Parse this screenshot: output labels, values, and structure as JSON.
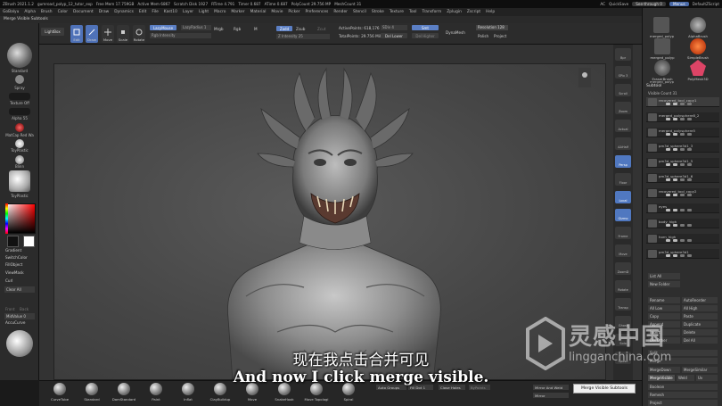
{
  "titlebar": {
    "app": "ZBrush 2021.1.2",
    "file": "gumroad_polyp_12_tutor_exp",
    "stats": [
      "Free Mem 17.759GB",
      "Active Mem 6867",
      "Scratch Disk 1927",
      "RTime 4.791",
      "Timer 0.687",
      "ATime 0.687",
      "PolyCount 29.756 MP",
      "MeshCount 31"
    ],
    "ac": "AC",
    "quicksave": "QuickSave",
    "see_through": "See-through 0",
    "menus_btn": "Menus",
    "script": "DefaultZScript"
  },
  "menubar": {
    "items": [
      "GoBalyu",
      "Alpha",
      "Brush",
      "Color",
      "Document",
      "Draw",
      "Dynamics",
      "Edit",
      "File",
      "Kast10",
      "Layer",
      "Light",
      "Macro",
      "Marker",
      "Material",
      "Movie",
      "Picker",
      "Preferences",
      "Render",
      "Stencil",
      "Stroke",
      "Texture",
      "Tool",
      "Transform",
      "Zplugin",
      "Zscript",
      "Help"
    ]
  },
  "subbar": {
    "label": "Merge Visible Subtools"
  },
  "toolbar": {
    "projection_master": "Projection Master",
    "lightbox": "LightBox",
    "edit": "Edit",
    "draw": "Draw",
    "move": "Move",
    "scale": "Scale",
    "rotate": "Rotate",
    "lazymouse": "LazyMouse",
    "lazyradius": "LazyRadius 1",
    "rgb_intensity": "Rgb Intensity",
    "mrgb": "Mrgb",
    "rgb": "Rgb",
    "m": "M",
    "zadd": "Zadd",
    "zsub": "Zsub",
    "zcut": "Zcut",
    "z_intensity": "Z Intensity 25",
    "focal_shift": "Focal Shift 0",
    "draw_size": "Draw Size 40",
    "active_points": "ActivePoints: 618,176",
    "total_points": "TotalPoints: 29.756 Mil",
    "sdiv": "SDiv 4",
    "del_lower": "Del Lower",
    "del_higher": "Del Higher",
    "dynamesh": "DynaMesh",
    "smt": "Smt",
    "resolution": "Resolution 128",
    "polish": "Polish",
    "project": "Project"
  },
  "left": {
    "standard": "Standard",
    "spray": "Spray",
    "texture_off": "Texture Off",
    "alpha": "Alpha 55",
    "matcap": "MatCap Red Wa",
    "toyplastic": "ToyPlastic",
    "blinn": "Blinn",
    "toyplastic2": "ToyPlastic",
    "gradient": "Gradient",
    "switchcolor": "SwitchColor",
    "fillobject": "FillObject",
    "viewmask": "ViewMask",
    "curl": "Curl",
    "clear_all": "Clear All",
    "front": "Front",
    "back": "Back",
    "midvalue": "MidValue 0",
    "accucurve": "AccuCurve"
  },
  "rightshelf": [
    "Bpr",
    "SPix 3",
    "Scroll",
    "Zoom",
    "Actual",
    "AAHalf",
    "Persp",
    "Floor",
    "Local",
    "Gizmo",
    "Frame",
    "Move",
    "ZoomD",
    "Rotate",
    "Transp",
    "Ghost",
    "Solo",
    "Xpose"
  ],
  "right": {
    "brushes": [
      "merged_polyp",
      "AlphaBrush",
      "merged_polyp",
      "SimpleBrush",
      "EraserBrush",
      "PolyMesh3D",
      "merged_polyp"
    ],
    "brush_count": "11",
    "subtool": "Subtool",
    "visible_count": "Visible Count 31",
    "rows": [
      "recovered_tool_copy1",
      "merged_polysphere8_2",
      "merged_polysphere5",
      "pm3d_sphere3d1_3",
      "pm3d_sphere3d1_5",
      "pm3d_sphere3d1_6",
      "recovered_tool_copy2",
      "eyes",
      "body_high",
      "horn_high",
      "pm3d_sphere3d1"
    ],
    "list_all": "List All",
    "new_folder": "New Folder",
    "rename": "Rename",
    "autoreorder": "AutoReorder",
    "all_low": "All Low",
    "all_high": "All High",
    "copy": "Copy",
    "paste": "Paste",
    "append": "Append",
    "duplicate": "Duplicate",
    "insert": "Insert",
    "delete": "Delete",
    "del_other": "Del Other",
    "del_all": "Del All",
    "split": "Split",
    "merge": "Merge",
    "mergedown": "MergeDown",
    "mergesimilar": "MergeSimilar",
    "mergevisible": "MergeVisible",
    "weld": "Weld",
    "uv": "Uv",
    "boolean": "Boolean",
    "remesh": "Remesh",
    "project": "Project"
  },
  "bottom": {
    "brushes": [
      "CurveTube",
      "Standard",
      "DamStandard",
      "Paint",
      "Inflat",
      "ClayBuildup",
      "Move",
      "SnakeHook",
      "Move Topologi",
      "Spiral"
    ],
    "auto_groups": "Auto Groups",
    "fill_dot": "Fill Dot 1",
    "close_holes": "Close Holes",
    "by_points": "ByPoints",
    "mirror_and_weld": "Mirror And Weld",
    "mirror": "Mirror"
  },
  "tooltip": "Merge Visible Subtools",
  "subtitles": {
    "cn": "现在我点击合并可见",
    "en": "And now I click merge visible."
  },
  "watermark": {
    "cn": "灵感中国",
    "en": "lingganchina.com"
  },
  "colors": {
    "accent": "#5b7fc4",
    "canvas": "#4a4a4a",
    "panel": "#2b2b2b"
  }
}
